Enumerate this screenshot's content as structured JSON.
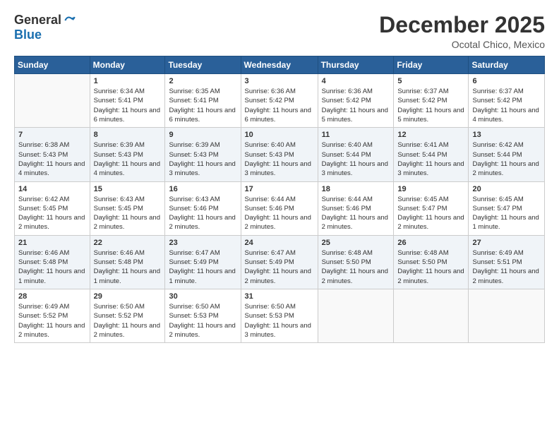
{
  "logo": {
    "general": "General",
    "blue": "Blue"
  },
  "title": "December 2025",
  "location": "Ocotal Chico, Mexico",
  "weekdays": [
    "Sunday",
    "Monday",
    "Tuesday",
    "Wednesday",
    "Thursday",
    "Friday",
    "Saturday"
  ],
  "weeks": [
    [
      {
        "day": "",
        "sunrise": "",
        "sunset": "",
        "daylight": ""
      },
      {
        "day": "1",
        "sunrise": "Sunrise: 6:34 AM",
        "sunset": "Sunset: 5:41 PM",
        "daylight": "Daylight: 11 hours and 6 minutes."
      },
      {
        "day": "2",
        "sunrise": "Sunrise: 6:35 AM",
        "sunset": "Sunset: 5:41 PM",
        "daylight": "Daylight: 11 hours and 6 minutes."
      },
      {
        "day": "3",
        "sunrise": "Sunrise: 6:36 AM",
        "sunset": "Sunset: 5:42 PM",
        "daylight": "Daylight: 11 hours and 6 minutes."
      },
      {
        "day": "4",
        "sunrise": "Sunrise: 6:36 AM",
        "sunset": "Sunset: 5:42 PM",
        "daylight": "Daylight: 11 hours and 5 minutes."
      },
      {
        "day": "5",
        "sunrise": "Sunrise: 6:37 AM",
        "sunset": "Sunset: 5:42 PM",
        "daylight": "Daylight: 11 hours and 5 minutes."
      },
      {
        "day": "6",
        "sunrise": "Sunrise: 6:37 AM",
        "sunset": "Sunset: 5:42 PM",
        "daylight": "Daylight: 11 hours and 4 minutes."
      }
    ],
    [
      {
        "day": "7",
        "sunrise": "Sunrise: 6:38 AM",
        "sunset": "Sunset: 5:43 PM",
        "daylight": "Daylight: 11 hours and 4 minutes."
      },
      {
        "day": "8",
        "sunrise": "Sunrise: 6:39 AM",
        "sunset": "Sunset: 5:43 PM",
        "daylight": "Daylight: 11 hours and 4 minutes."
      },
      {
        "day": "9",
        "sunrise": "Sunrise: 6:39 AM",
        "sunset": "Sunset: 5:43 PM",
        "daylight": "Daylight: 11 hours and 3 minutes."
      },
      {
        "day": "10",
        "sunrise": "Sunrise: 6:40 AM",
        "sunset": "Sunset: 5:43 PM",
        "daylight": "Daylight: 11 hours and 3 minutes."
      },
      {
        "day": "11",
        "sunrise": "Sunrise: 6:40 AM",
        "sunset": "Sunset: 5:44 PM",
        "daylight": "Daylight: 11 hours and 3 minutes."
      },
      {
        "day": "12",
        "sunrise": "Sunrise: 6:41 AM",
        "sunset": "Sunset: 5:44 PM",
        "daylight": "Daylight: 11 hours and 3 minutes."
      },
      {
        "day": "13",
        "sunrise": "Sunrise: 6:42 AM",
        "sunset": "Sunset: 5:44 PM",
        "daylight": "Daylight: 11 hours and 2 minutes."
      }
    ],
    [
      {
        "day": "14",
        "sunrise": "Sunrise: 6:42 AM",
        "sunset": "Sunset: 5:45 PM",
        "daylight": "Daylight: 11 hours and 2 minutes."
      },
      {
        "day": "15",
        "sunrise": "Sunrise: 6:43 AM",
        "sunset": "Sunset: 5:45 PM",
        "daylight": "Daylight: 11 hours and 2 minutes."
      },
      {
        "day": "16",
        "sunrise": "Sunrise: 6:43 AM",
        "sunset": "Sunset: 5:46 PM",
        "daylight": "Daylight: 11 hours and 2 minutes."
      },
      {
        "day": "17",
        "sunrise": "Sunrise: 6:44 AM",
        "sunset": "Sunset: 5:46 PM",
        "daylight": "Daylight: 11 hours and 2 minutes."
      },
      {
        "day": "18",
        "sunrise": "Sunrise: 6:44 AM",
        "sunset": "Sunset: 5:46 PM",
        "daylight": "Daylight: 11 hours and 2 minutes."
      },
      {
        "day": "19",
        "sunrise": "Sunrise: 6:45 AM",
        "sunset": "Sunset: 5:47 PM",
        "daylight": "Daylight: 11 hours and 2 minutes."
      },
      {
        "day": "20",
        "sunrise": "Sunrise: 6:45 AM",
        "sunset": "Sunset: 5:47 PM",
        "daylight": "Daylight: 11 hours and 1 minute."
      }
    ],
    [
      {
        "day": "21",
        "sunrise": "Sunrise: 6:46 AM",
        "sunset": "Sunset: 5:48 PM",
        "daylight": "Daylight: 11 hours and 1 minute."
      },
      {
        "day": "22",
        "sunrise": "Sunrise: 6:46 AM",
        "sunset": "Sunset: 5:48 PM",
        "daylight": "Daylight: 11 hours and 1 minute."
      },
      {
        "day": "23",
        "sunrise": "Sunrise: 6:47 AM",
        "sunset": "Sunset: 5:49 PM",
        "daylight": "Daylight: 11 hours and 1 minute."
      },
      {
        "day": "24",
        "sunrise": "Sunrise: 6:47 AM",
        "sunset": "Sunset: 5:49 PM",
        "daylight": "Daylight: 11 hours and 2 minutes."
      },
      {
        "day": "25",
        "sunrise": "Sunrise: 6:48 AM",
        "sunset": "Sunset: 5:50 PM",
        "daylight": "Daylight: 11 hours and 2 minutes."
      },
      {
        "day": "26",
        "sunrise": "Sunrise: 6:48 AM",
        "sunset": "Sunset: 5:50 PM",
        "daylight": "Daylight: 11 hours and 2 minutes."
      },
      {
        "day": "27",
        "sunrise": "Sunrise: 6:49 AM",
        "sunset": "Sunset: 5:51 PM",
        "daylight": "Daylight: 11 hours and 2 minutes."
      }
    ],
    [
      {
        "day": "28",
        "sunrise": "Sunrise: 6:49 AM",
        "sunset": "Sunset: 5:52 PM",
        "daylight": "Daylight: 11 hours and 2 minutes."
      },
      {
        "day": "29",
        "sunrise": "Sunrise: 6:50 AM",
        "sunset": "Sunset: 5:52 PM",
        "daylight": "Daylight: 11 hours and 2 minutes."
      },
      {
        "day": "30",
        "sunrise": "Sunrise: 6:50 AM",
        "sunset": "Sunset: 5:53 PM",
        "daylight": "Daylight: 11 hours and 2 minutes."
      },
      {
        "day": "31",
        "sunrise": "Sunrise: 6:50 AM",
        "sunset": "Sunset: 5:53 PM",
        "daylight": "Daylight: 11 hours and 3 minutes."
      },
      {
        "day": "",
        "sunrise": "",
        "sunset": "",
        "daylight": ""
      },
      {
        "day": "",
        "sunrise": "",
        "sunset": "",
        "daylight": ""
      },
      {
        "day": "",
        "sunrise": "",
        "sunset": "",
        "daylight": ""
      }
    ]
  ]
}
